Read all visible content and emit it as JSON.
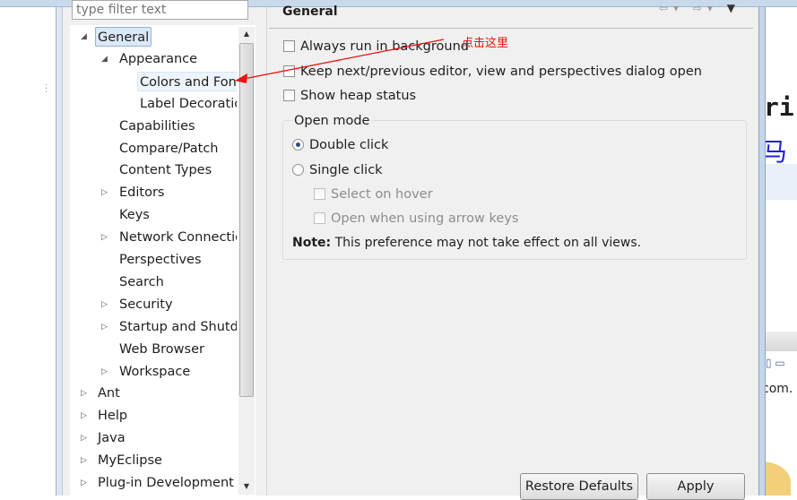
{
  "filter": {
    "placeholder": "type filter text"
  },
  "tree": {
    "items": [
      {
        "label": "General",
        "level": 0,
        "expanded": true,
        "selected": true
      },
      {
        "label": "Appearance",
        "level": 1,
        "expanded": true
      },
      {
        "label": "Colors and Fonts",
        "level": 2,
        "hover": true
      },
      {
        "label": "Label Decorations",
        "level": 2
      },
      {
        "label": "Capabilities",
        "level": 1
      },
      {
        "label": "Compare/Patch",
        "level": 1
      },
      {
        "label": "Content Types",
        "level": 1
      },
      {
        "label": "Editors",
        "level": 1,
        "collapsed": true
      },
      {
        "label": "Keys",
        "level": 1
      },
      {
        "label": "Network Connections",
        "level": 1,
        "collapsed": true
      },
      {
        "label": "Perspectives",
        "level": 1
      },
      {
        "label": "Search",
        "level": 1
      },
      {
        "label": "Security",
        "level": 1,
        "collapsed": true
      },
      {
        "label": "Startup and Shutdown",
        "level": 1,
        "collapsed": true
      },
      {
        "label": "Web Browser",
        "level": 1
      },
      {
        "label": "Workspace",
        "level": 1,
        "collapsed": true
      },
      {
        "label": "Ant",
        "level": 0,
        "collapsed": true
      },
      {
        "label": "Help",
        "level": 0,
        "collapsed": true
      },
      {
        "label": "Java",
        "level": 0,
        "collapsed": true
      },
      {
        "label": "MyEclipse",
        "level": 0,
        "collapsed": true
      },
      {
        "label": "Plug-in Development",
        "level": 0,
        "collapsed": true
      }
    ]
  },
  "page": {
    "title": "General",
    "options": [
      {
        "label": "Always run in background",
        "checked": false
      },
      {
        "label": "Keep next/previous editor, view and perspectives dialog open",
        "checked": false
      },
      {
        "label": "Show heap status",
        "checked": false
      }
    ],
    "open_mode": {
      "label": "Open mode",
      "double_click": "Double click",
      "single_click": "Single click",
      "selected": "Double click",
      "select_on_hover": "Select on hover",
      "open_arrow_keys": "Open when using arrow keys",
      "note_bold": "Note:",
      "note_text": " This preference may not take effect on all views."
    },
    "restore_defaults": "Restore Defaults",
    "apply": "Apply"
  },
  "annotation": {
    "text": "点击这里",
    "color": "#e11111"
  },
  "editor_fragments": {
    "code": "ri",
    "chinese": "马",
    "url": "com."
  }
}
